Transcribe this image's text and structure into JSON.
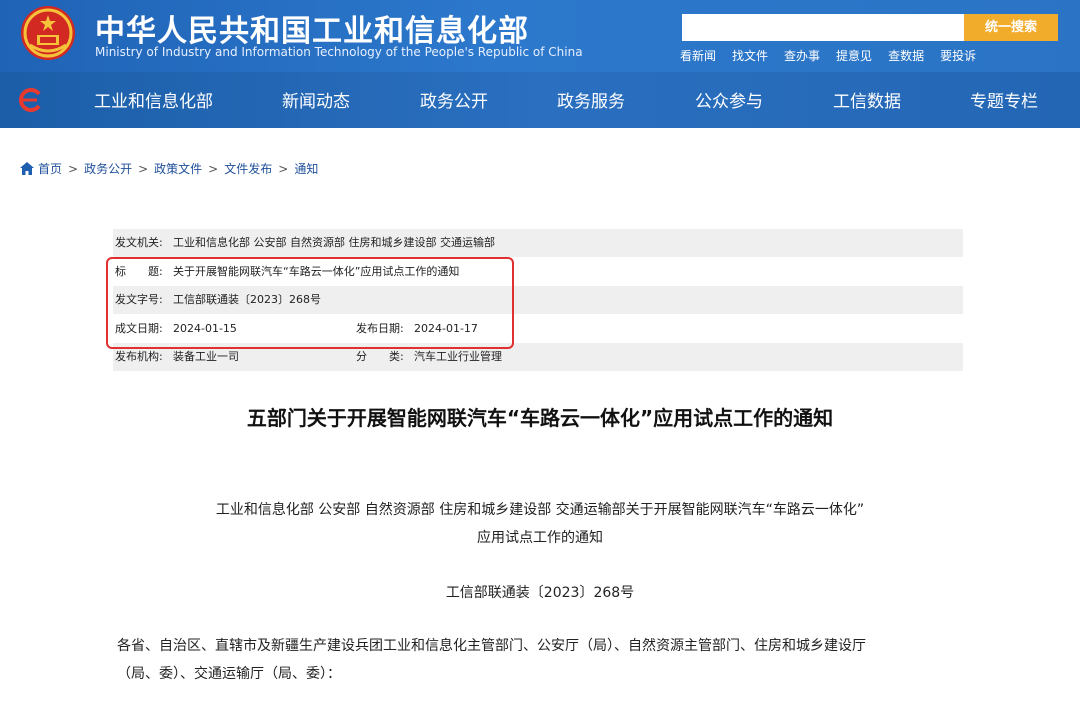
{
  "header": {
    "title": "中华人民共和国工业和信息化部",
    "subtitle": "Ministry of Industry and Information Technology of the People's Republic of China",
    "search_placeholder": "",
    "search_button": "统一搜索",
    "quick_links": [
      "看新闻",
      "找文件",
      "查办事",
      "提意见",
      "查数据",
      "要投诉"
    ]
  },
  "nav": {
    "items": [
      "工业和信息化部",
      "新闻动态",
      "政务公开",
      "政务服务",
      "公众参与",
      "工信数据",
      "专题专栏"
    ]
  },
  "breadcrumb": [
    "首页",
    "政务公开",
    "政策文件",
    "文件发布",
    "通知"
  ],
  "meta": {
    "issuer_label": "发文机关:",
    "issuer": "工业和信息化部 公安部 自然资源部 住房和城乡建设部 交通运输部",
    "title_label": "标　　题:",
    "title": "关于开展智能网联汽车“车路云一体化”应用试点工作的通知",
    "docno_label": "发文字号:",
    "docno": "工信部联通装〔2023〕268号",
    "written_label": "成文日期:",
    "written": "2024-01-15",
    "published_label": "发布日期:",
    "published": "2024-01-17",
    "org_label": "发布机构:",
    "org": "装备工业一司",
    "category_label": "分　　类:",
    "category": "汽车工业行业管理"
  },
  "document": {
    "title": "五部门关于开展智能网联汽车“车路云一体化”应用试点工作的通知",
    "subtitle_line1": "工业和信息化部 公安部 自然资源部 住房和城乡建设部 交通运输部关于开展智能网联汽车“车路云一体化”",
    "subtitle_line2": "应用试点工作的通知",
    "number": "工信部联通装〔2023〕268号",
    "body_line1": "各省、自治区、直辖市及新疆生产建设兵团工业和信息化主管部门、公安厅（局）、自然资源主管部门、住房和城乡建设厅",
    "body_line2": "（局、委）、交通运输厅（局、委）："
  },
  "colors": {
    "header_blue": "#2b74c5",
    "search_button": "#f2ac2c",
    "highlight_border": "#e03030",
    "breadcrumb_link": "#1f4f99"
  },
  "icons": [
    "national-emblem-icon",
    "site-logo-icon",
    "home-icon"
  ]
}
